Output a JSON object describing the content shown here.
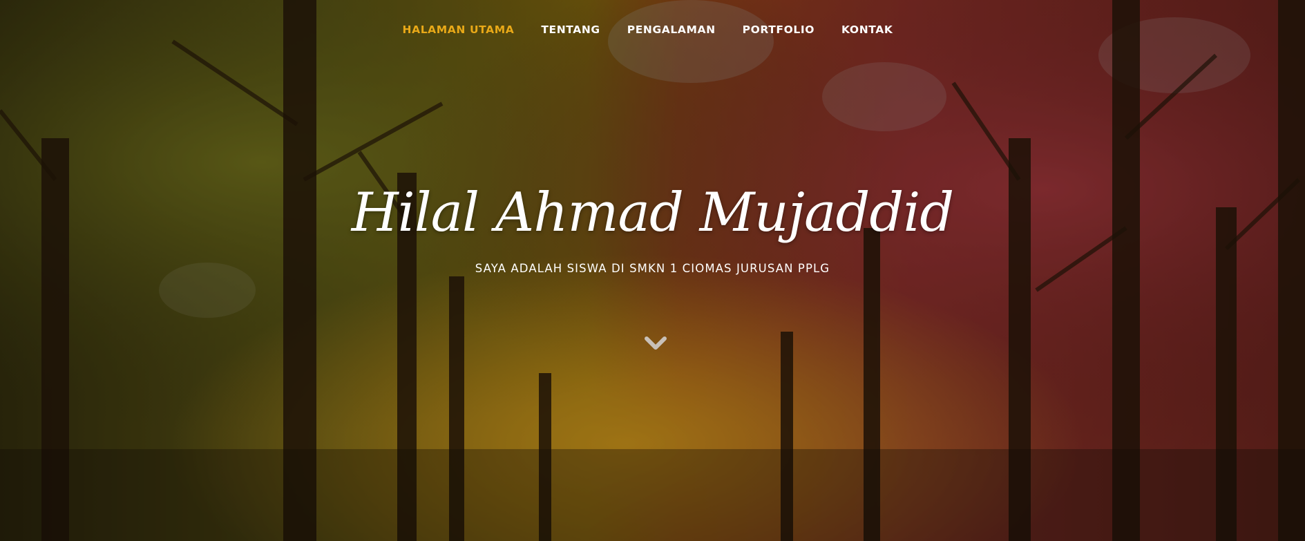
{
  "nav": {
    "items": [
      {
        "label": "HALAMAN UTAMA"
      },
      {
        "label": "TENTANG"
      },
      {
        "label": "PENGALAMAN"
      },
      {
        "label": "PORTFOLIO"
      },
      {
        "label": "KONTAK"
      }
    ],
    "active_color": "#e9a918"
  },
  "hero": {
    "title": "Hilal Ahmad Mujaddid",
    "subtitle": "SAYA ADALAH SISWA DI SMKN 1 CIOMAS JURUSAN PPLG",
    "scroll_icon": "chevron-down-icon",
    "background": "autumn forest avenue photo"
  }
}
